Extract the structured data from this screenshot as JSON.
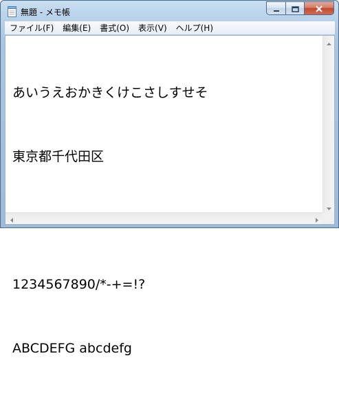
{
  "window": {
    "title": "無題 - メモ帳"
  },
  "menu": {
    "items": [
      {
        "label": "ファイル(F)"
      },
      {
        "label": "編集(E)"
      },
      {
        "label": "書式(O)"
      },
      {
        "label": "表示(V)"
      },
      {
        "label": "ヘルプ(H)"
      }
    ]
  },
  "editor": {
    "lines": [
      "あいうえおかきくけこさしすせそ",
      "東京都千代田区",
      "",
      "1234567890/*-+=!?",
      "ABCDEFG abcdefg"
    ]
  },
  "icons": {
    "app": "notepad-icon",
    "minimize": "minimize-icon",
    "maximize": "maximize-icon",
    "close": "close-icon",
    "scroll_up": "chevron-up-icon",
    "scroll_down": "chevron-down-icon",
    "scroll_left": "chevron-left-icon",
    "scroll_right": "chevron-right-icon"
  },
  "colors": {
    "title_bar": "#b6d0e9",
    "close_button": "#c14a30",
    "editor_background": "#ffffff"
  }
}
